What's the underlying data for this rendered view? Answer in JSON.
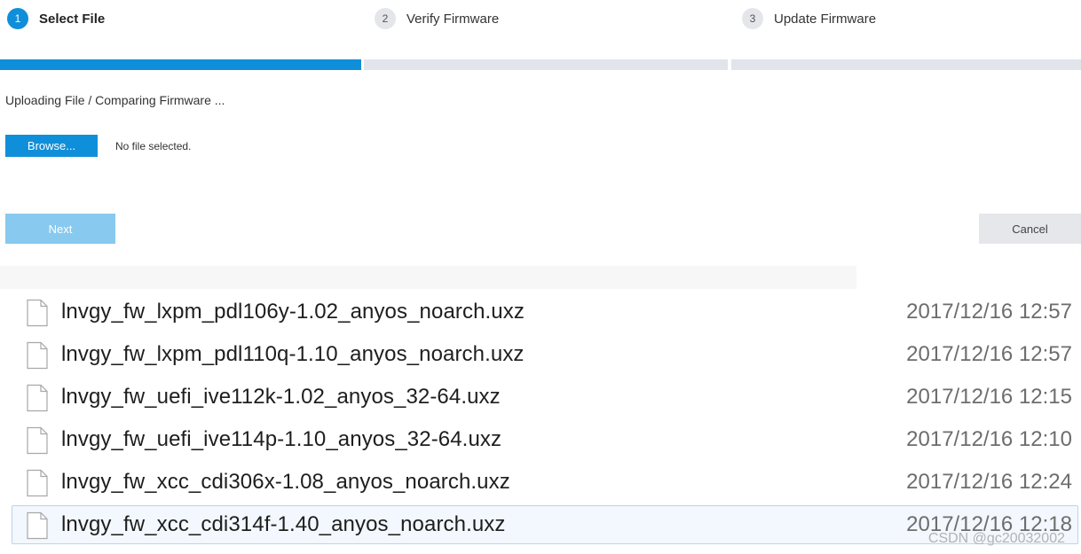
{
  "wizard": {
    "steps": [
      {
        "number": "1",
        "label": "Select File",
        "active": true
      },
      {
        "number": "2",
        "label": "Verify Firmware",
        "active": false
      },
      {
        "number": "3",
        "label": "Update Firmware",
        "active": false
      }
    ]
  },
  "colors": {
    "accent": "#0f8fd9",
    "accent_disabled": "#88c9ef",
    "inactive_track": "#e1e4ea",
    "cancel_bg": "#e5e7eb"
  },
  "upload": {
    "status": "Uploading File / Comparing Firmware ...",
    "browse_label": "Browse...",
    "file_state": "No file selected."
  },
  "actions": {
    "next_label": "Next",
    "cancel_label": "Cancel"
  },
  "file_list": {
    "icon": "document-icon",
    "files": [
      {
        "name": "lnvgy_fw_lxpm_pdl106y-1.02_anyos_noarch.uxz",
        "date": "2017/12/16 12:57",
        "selected": false
      },
      {
        "name": "lnvgy_fw_lxpm_pdl110q-1.10_anyos_noarch.uxz",
        "date": "2017/12/16 12:57",
        "selected": false
      },
      {
        "name": "lnvgy_fw_uefi_ive112k-1.02_anyos_32-64.uxz",
        "date": "2017/12/16 12:15",
        "selected": false
      },
      {
        "name": "lnvgy_fw_uefi_ive114p-1.10_anyos_32-64.uxz",
        "date": "2017/12/16 12:10",
        "selected": false
      },
      {
        "name": "lnvgy_fw_xcc_cdi306x-1.08_anyos_noarch.uxz",
        "date": "2017/12/16 12:24",
        "selected": false
      },
      {
        "name": "lnvgy_fw_xcc_cdi314f-1.40_anyos_noarch.uxz",
        "date": "2017/12/16 12:18",
        "selected": true
      }
    ]
  },
  "watermark": "CSDN @gc20032002"
}
